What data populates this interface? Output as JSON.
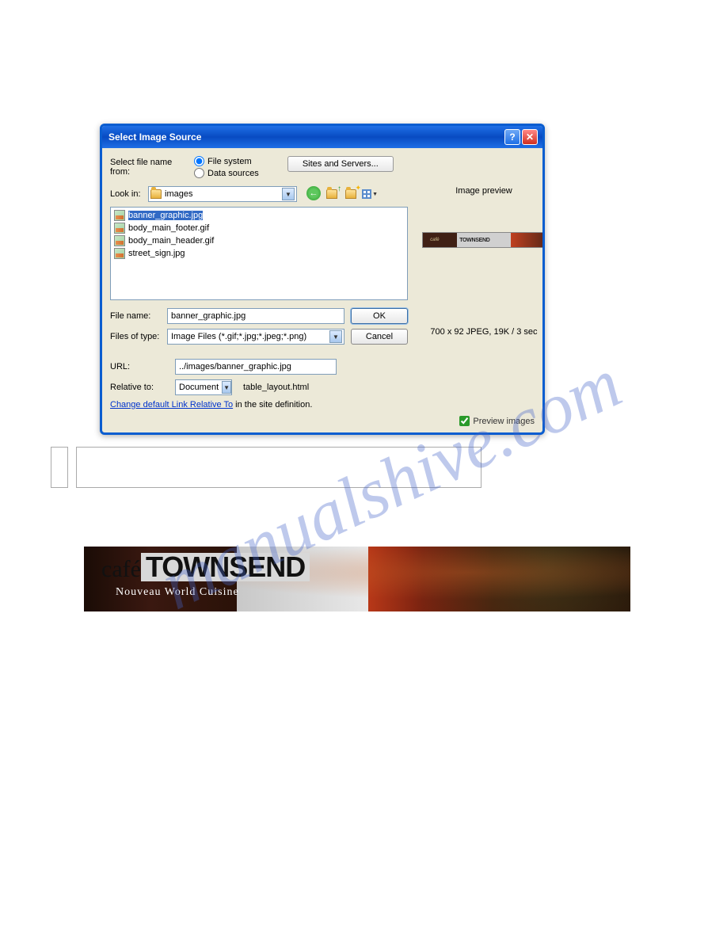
{
  "dialog": {
    "title": "Select Image Source",
    "select_from_label": "Select file name from:",
    "radio_filesystem": "File system",
    "radio_datasources": "Data sources",
    "sites_servers_btn": "Sites and Servers...",
    "lookin_label": "Look in:",
    "lookin_value": "images",
    "files": [
      "banner_graphic.jpg",
      "body_main_footer.gif",
      "body_main_header.gif",
      "street_sign.jpg"
    ],
    "filename_label": "File name:",
    "filename_value": "banner_graphic.jpg",
    "filetype_label": "Files of type:",
    "filetype_value": "Image Files (*.gif;*.jpg;*.jpeg;*.png)",
    "ok_btn": "OK",
    "cancel_btn": "Cancel",
    "url_label": "URL:",
    "url_value": "../images/banner_graphic.jpg",
    "relative_label": "Relative to:",
    "relative_value": "Document",
    "relative_suffix": "table_layout.html",
    "change_link": "Change default Link Relative To",
    "change_suffix": " in the site definition.",
    "preview_checkbox": "Preview images",
    "preview_heading": "Image preview",
    "preview_cafe": "café",
    "preview_brand": "TOWNSEND",
    "preview_meta": "700 x 92 JPEG, 19K / 3 sec"
  },
  "banner": {
    "cafe": "café",
    "main": "TOWNSEND",
    "sub": "Nouveau World Cuisine"
  },
  "watermark": "manualshive.com"
}
